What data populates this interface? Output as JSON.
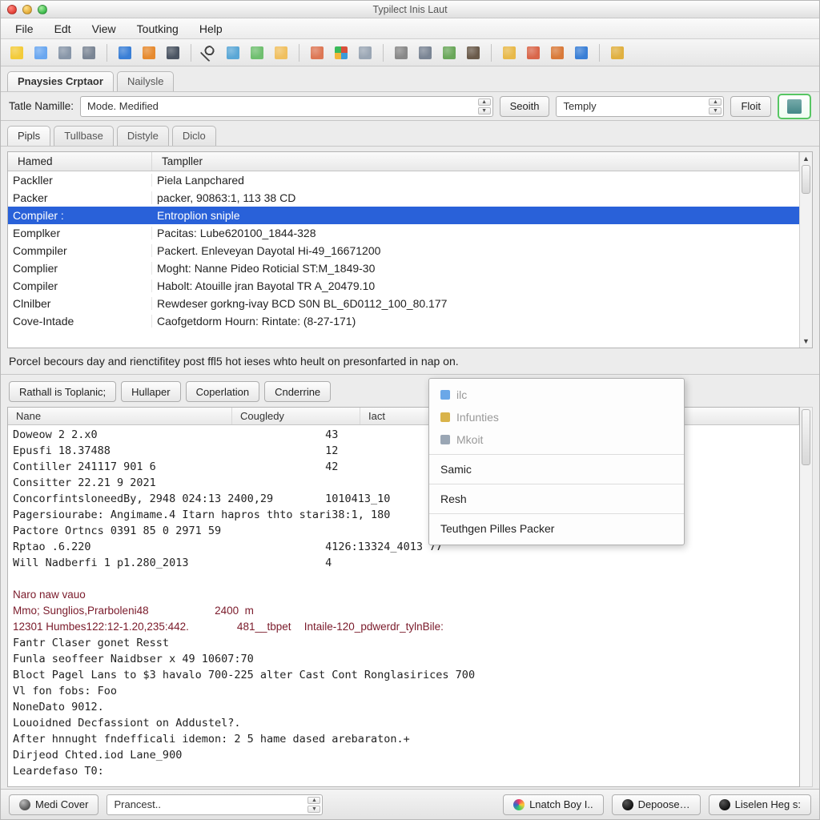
{
  "window": {
    "title": "Typilect Inis Laut"
  },
  "menu": {
    "file": "File",
    "edit": "Edt",
    "view": "View",
    "tools": "Toutking",
    "help": "Help"
  },
  "toolbar_icons": [
    {
      "name": "bulb-icon",
      "color": "#f3cb3a"
    },
    {
      "name": "ruler-icon",
      "color": "#6aa7f0"
    },
    {
      "name": "note-icon",
      "color": "#8896a8"
    },
    {
      "name": "tools-icon",
      "color": "#7a8594"
    },
    {
      "name": "globe-icon",
      "color": "#3a7fd6"
    },
    {
      "name": "pie-icon",
      "color": "#e68a2f"
    },
    {
      "name": "filter-icon",
      "color": "#4a5462"
    },
    {
      "name": "search-icon",
      "color": "#444"
    },
    {
      "name": "bug-icon",
      "color": "#5aa7d6"
    },
    {
      "name": "globe2-icon",
      "color": "#6fbf6f"
    },
    {
      "name": "folder-icon",
      "color": "#f0c060"
    },
    {
      "name": "image-icon",
      "color": "#dd7755"
    },
    {
      "name": "grid-icon",
      "color": "#d94f3a,#3a9bd9,#f3b63a,#3aba5a"
    },
    {
      "name": "window-icon",
      "color": "#9aa6b4"
    },
    {
      "name": "disk-icon",
      "color": "#888"
    },
    {
      "name": "gear-icon",
      "color": "#7a8594"
    },
    {
      "name": "page-add-icon",
      "color": "#6aa75a"
    },
    {
      "name": "chess-icon",
      "color": "#6a5a4a"
    },
    {
      "name": "folder2-icon",
      "color": "#e8b94a"
    },
    {
      "name": "globe-stop-icon",
      "color": "#d9664a"
    },
    {
      "name": "cut-icon",
      "color": "#d97a3a"
    },
    {
      "name": "help-icon",
      "color": "#3a7fd6"
    },
    {
      "name": "pin-icon",
      "color": "#e0b040"
    }
  ],
  "toptabs": {
    "active": "Pnaysies Crptaor",
    "other": "Nailysle"
  },
  "filter": {
    "label": "Tatle Namille:",
    "combo1": "Mode. Medified",
    "search_btn": "Seoith",
    "combo2": "Temply",
    "float_btn": "Floit"
  },
  "subtabs": [
    "Pipls",
    "Tullbase",
    "Distyle",
    "Diclo"
  ],
  "table": {
    "headers": [
      "Hamed",
      "Tampller"
    ],
    "rows": [
      {
        "c1": "Packller",
        "c2": "Piela Lanpchared"
      },
      {
        "c1": "Packer",
        "c2": "packer, 90863:1, 113 38 CD"
      },
      {
        "c1": "Compiler :",
        "c2": "Entroplion sniple",
        "selected": true
      },
      {
        "c1": "Eomplker",
        "c2": "Pacitas: Lube620100_1844-328"
      },
      {
        "c1": "Commpiler",
        "c2": "Packert. Enleveyan Dayotal Hi-49_16671200"
      },
      {
        "c1": "Complier",
        "c2": "Moght: Nanne Pideo Roticial ST:M_1849-30"
      },
      {
        "c1": "Compiler",
        "c2": "Habolt: Atouille jran Bayotal TR A_20479.10"
      },
      {
        "c1": "Clnilber",
        "c2": "Rewdeser gorkng-ivay BCD S0N BL_6D0112_100_80.177"
      },
      {
        "c1": "Cove-Intade",
        "c2": "Caofgetdorm Hourn: Rintate: (8-27-171)"
      }
    ]
  },
  "status": "Porcel becours day and rienctifitey post ffl5 hot ieses whto heult on presonfarted in nap on.",
  "lowerbtns": [
    "Rathall is Toplanic;",
    "Hullaper",
    "Coperlation",
    "Cnderrine"
  ],
  "loghead": [
    "Nane",
    "Cougledy",
    "Iact"
  ],
  "log_lines": [
    {
      "a": "Doweow 2 2.x0",
      "r": "43"
    },
    {
      "a": "Epusfi 18.37488",
      "r": "12"
    },
    {
      "a": "Contiller 241117 901 6",
      "r": "42"
    },
    {
      "a": "Consitter 22.21 9 2021",
      "r": ""
    },
    {
      "a": "ConcorfintsloneedBy, 2948 024:13 2400,29",
      "r": "1010413_10"
    },
    {
      "a": "Pagersiourabe: Angimame.4 Itarn hapros thto star",
      "r": "i38:1, 180"
    },
    {
      "a": "Pactore Ortncs 0391 85 0 2971 59",
      "r": ""
    },
    {
      "a": "Rptao .6.220",
      "r": "4126:13324_4013 77"
    },
    {
      "a": "Will Nadberfi 1 p1.280_2013",
      "r": "4"
    }
  ],
  "log_dark1": {
    "a": "Naro naw vauo",
    "r": ""
  },
  "log_dark2": {
    "a": "Mmo; Sunglios,Prarboleni48",
    "r": "2400  m"
  },
  "log_dark3": {
    "a": "12301 Humbes122:12-1.20,235:442.",
    "r": "481__tbpet"
  },
  "log_dark_right": "Intaile-120_pdwerdr_tylnBile:",
  "log_tail": [
    "Fantr Claser gonet Resst",
    "Funla seoffeer Naidbser x 49 10607:70",
    "Bloct Pagel Lans to $3 havalo 700-225 alter Cast Cont Ronglasirices 700",
    "Vl fon fobs: Foo",
    "NoneDato 9012.",
    "Louoidned Decfassiont on Addustel?.",
    "After hnnught fndefficali idemon: 2 5 hame dased arebaraton.+",
    "Dirjeod Chted.iod Lane_900",
    "Leardefaso T0:"
  ],
  "popup": {
    "dis1": "ilc",
    "dis2": "Infunties",
    "dis3": "Mkoit",
    "en1": "Samic",
    "en2": "Resh",
    "en3": "Teuthgen Pilles Packer"
  },
  "bottom": {
    "medi": "Medi Cover",
    "combo": "Prancest..",
    "latch": "Lnatch Boy I..",
    "depoose": "Depoose…",
    "liselen": "Liselen Heg s:"
  }
}
